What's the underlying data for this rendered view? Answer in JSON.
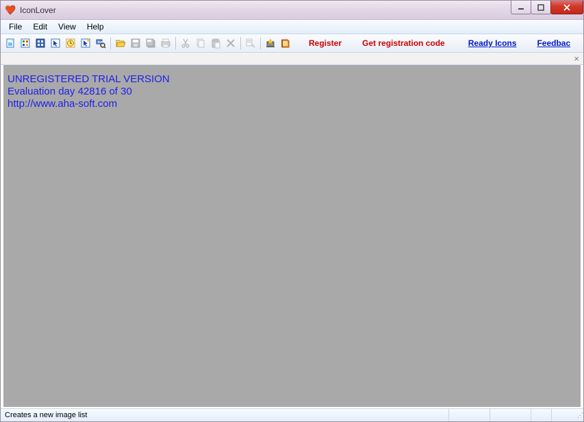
{
  "window": {
    "title": "IconLover"
  },
  "menu": {
    "file": "File",
    "edit": "Edit",
    "view": "View",
    "help": "Help"
  },
  "toolbar": {
    "links": {
      "register": "Register",
      "get_code": "Get registration code",
      "ready_icons": "Ready Icons",
      "feedback": "Feedbac"
    },
    "icons": {
      "i0": "new-image",
      "i1": "new-list",
      "i2": "new-library",
      "i3": "new-cursor",
      "i4": "new-clock",
      "i5": "new-anim",
      "i6": "new-search",
      "i7": "open",
      "i8": "save",
      "i9": "save-all",
      "i10": "print",
      "i11": "cut",
      "i12": "copy",
      "i13": "paste",
      "i14": "delete",
      "i15": "properties",
      "i16": "wizard",
      "i17": "book"
    }
  },
  "trial": {
    "line1": "UNREGISTERED TRIAL VERSION",
    "line2": "Evaluation day 42816 of 30",
    "line3": "http://www.aha-soft.com"
  },
  "status": {
    "text": "Creates a new image list"
  }
}
